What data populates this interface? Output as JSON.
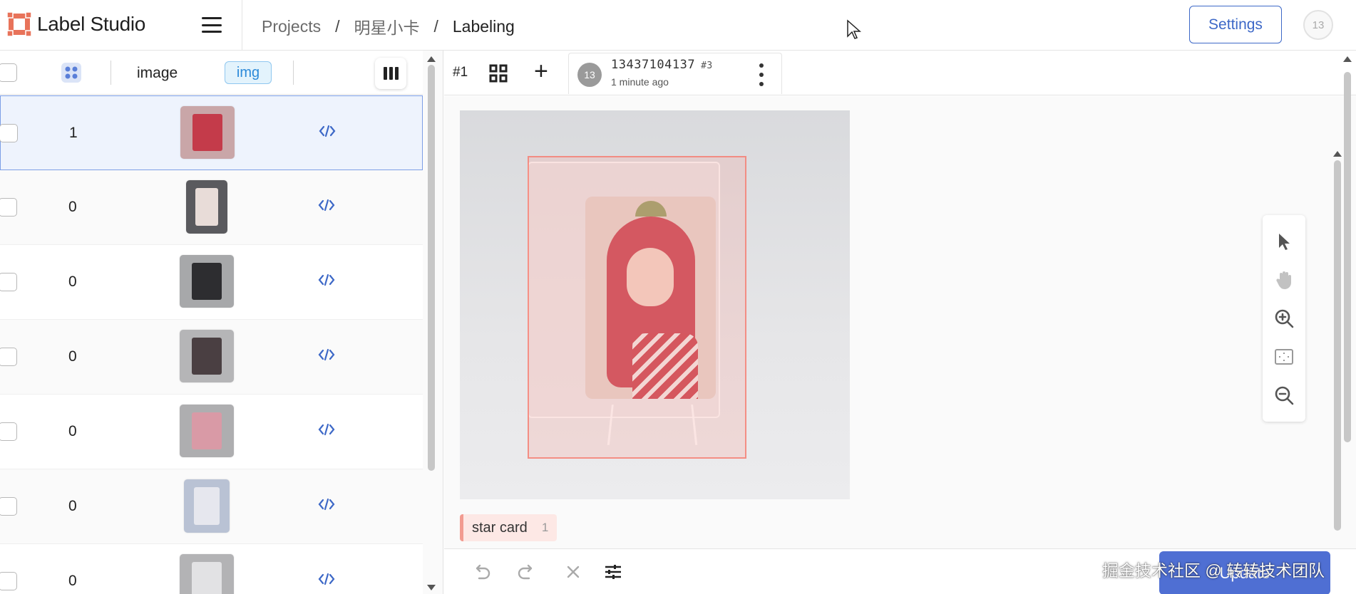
{
  "header": {
    "app_name": "Label Studio",
    "breadcrumb": [
      {
        "label": "Projects"
      },
      {
        "label": "明星小卡"
      },
      {
        "label": "Labeling"
      }
    ],
    "separator": "/",
    "settings_label": "Settings",
    "user_initials": "13"
  },
  "table": {
    "columns": {
      "image": "image",
      "img_tag": "img"
    },
    "rows": [
      {
        "count": "1",
        "thumb_color": "#c9a6a8",
        "thumb_accent": "#c43b4a",
        "selected": true
      },
      {
        "count": "0",
        "thumb_color": "#5a5a5e",
        "thumb_accent": "#e8dcd8",
        "selected": false
      },
      {
        "count": "0",
        "thumb_color": "#a7a8aa",
        "thumb_accent": "#2d2d30",
        "selected": false
      },
      {
        "count": "0",
        "thumb_color": "#b5b5b7",
        "thumb_accent": "#4a3f42",
        "selected": false
      },
      {
        "count": "0",
        "thumb_color": "#aeaeb0",
        "thumb_accent": "#d99aa6",
        "selected": false
      },
      {
        "count": "0",
        "thumb_color": "#b9c2d4",
        "thumb_accent": "#e6e7ee",
        "selected": false
      },
      {
        "count": "0",
        "thumb_color": "#b3b3b5",
        "thumb_accent": "#e2e2e4",
        "selected": false
      }
    ]
  },
  "annotation": {
    "task_number": "#1",
    "user_avatar": "13",
    "user_name": "13437104137",
    "annotation_id": "#3",
    "time_ago": "1 minute ago"
  },
  "labels": [
    {
      "name": "star card",
      "count": "1",
      "color": "#f29b90"
    }
  ],
  "tools": [
    "pointer-icon",
    "pan-hand-icon",
    "zoom-in-icon",
    "fit-to-screen-icon",
    "zoom-out-icon"
  ],
  "actions": {
    "update_label": "Update"
  },
  "watermark": "掘金技术社区 @ 转转技术团队",
  "colors": {
    "accent": "#4f6fd3",
    "settings_border": "#3d68c7",
    "logo": "#e8735a",
    "region": "#f29b90"
  }
}
